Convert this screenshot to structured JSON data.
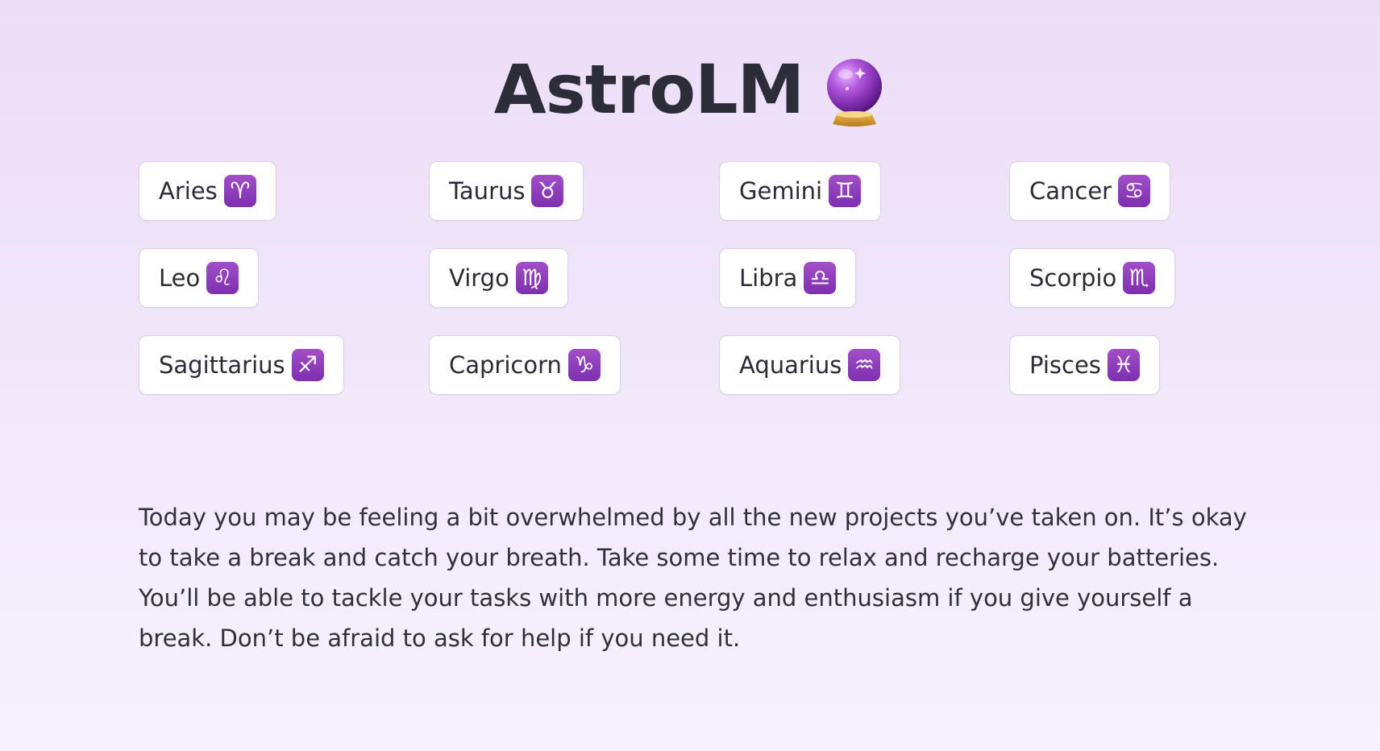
{
  "app": {
    "title": "AstroLM",
    "title_icon": "crystal-ball-icon"
  },
  "signs": [
    {
      "label": "Aries",
      "glyph": "♈"
    },
    {
      "label": "Taurus",
      "glyph": "♉"
    },
    {
      "label": "Gemini",
      "glyph": "♊"
    },
    {
      "label": "Cancer",
      "glyph": "♋"
    },
    {
      "label": "Leo",
      "glyph": "♌"
    },
    {
      "label": "Virgo",
      "glyph": "♍"
    },
    {
      "label": "Libra",
      "glyph": "♎"
    },
    {
      "label": "Scorpio",
      "glyph": "♏"
    },
    {
      "label": "Sagittarius",
      "glyph": "♐"
    },
    {
      "label": "Capricorn",
      "glyph": "♑"
    },
    {
      "label": "Aquarius",
      "glyph": "♒"
    },
    {
      "label": "Pisces",
      "glyph": "♓"
    }
  ],
  "horoscope": {
    "text": "Today you may be feeling a bit overwhelmed by all the new projects you’ve taken on. It’s okay to take a break and catch your breath. Take some time to relax and recharge your batteries. You’ll be able to tackle your tasks with more energy and enthusiasm if you give yourself a break. Don’t be afraid to ask for help if you need it."
  },
  "colors": {
    "background_top": "#ebdff8",
    "background_bottom": "#f7f2fd",
    "glyph_badge": "#8e3cbc",
    "text": "#2d2d3a"
  }
}
